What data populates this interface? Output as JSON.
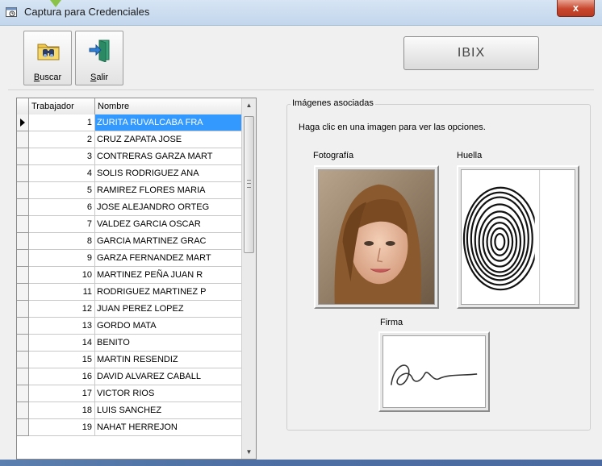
{
  "window": {
    "title": "Captura para Credenciales",
    "close_label": "x"
  },
  "toolbar": {
    "buscar": {
      "label_underlined": "B",
      "label_rest": "uscar",
      "icon": "binoculars-folder-icon"
    },
    "salir": {
      "label_underlined": "S",
      "label_rest": "alir",
      "icon": "exit-door-icon"
    },
    "ibix_label": "IBIX"
  },
  "grid": {
    "columns": [
      "Trabajador",
      "Nombre"
    ],
    "rows": [
      {
        "num": "1",
        "name": "ZURITA RUVALCABA FRA"
      },
      {
        "num": "2",
        "name": "CRUZ ZAPATA JOSE"
      },
      {
        "num": "3",
        "name": "CONTRERAS GARZA MART"
      },
      {
        "num": "4",
        "name": "SOLIS RODRIGUEZ ANA"
      },
      {
        "num": "5",
        "name": "RAMIREZ FLORES MARIA"
      },
      {
        "num": "6",
        "name": "JOSE ALEJANDRO ORTEG"
      },
      {
        "num": "7",
        "name": "VALDEZ GARCIA OSCAR"
      },
      {
        "num": "8",
        "name": "GARCIA MARTINEZ GRAC"
      },
      {
        "num": "9",
        "name": "GARZA FERNANDEZ MART"
      },
      {
        "num": "10",
        "name": "MARTINEZ PEÑA JUAN R"
      },
      {
        "num": "11",
        "name": "RODRIGUEZ MARTINEZ P"
      },
      {
        "num": "12",
        "name": "JUAN PEREZ LOPEZ"
      },
      {
        "num": "13",
        "name": "GORDO MATA"
      },
      {
        "num": "14",
        "name": "BENITO"
      },
      {
        "num": "15",
        "name": "MARTIN RESENDIZ"
      },
      {
        "num": "16",
        "name": "DAVID ALVAREZ CABALL"
      },
      {
        "num": "17",
        "name": "VICTOR RIOS"
      },
      {
        "num": "18",
        "name": "LUIS SANCHEZ"
      },
      {
        "num": "19",
        "name": "NAHAT HERREJON"
      }
    ],
    "selected_row": 1
  },
  "images": {
    "group_title": "Imágenes asociadas",
    "hint": "Haga clic en una imagen para ver las opciones.",
    "photo_label": "Fotografía",
    "fingerprint_label": "Huella",
    "signature_label": "Firma"
  },
  "colors": {
    "selection": "#3399ff",
    "titlebar": "#c9dcef",
    "close": "#c8462d"
  }
}
